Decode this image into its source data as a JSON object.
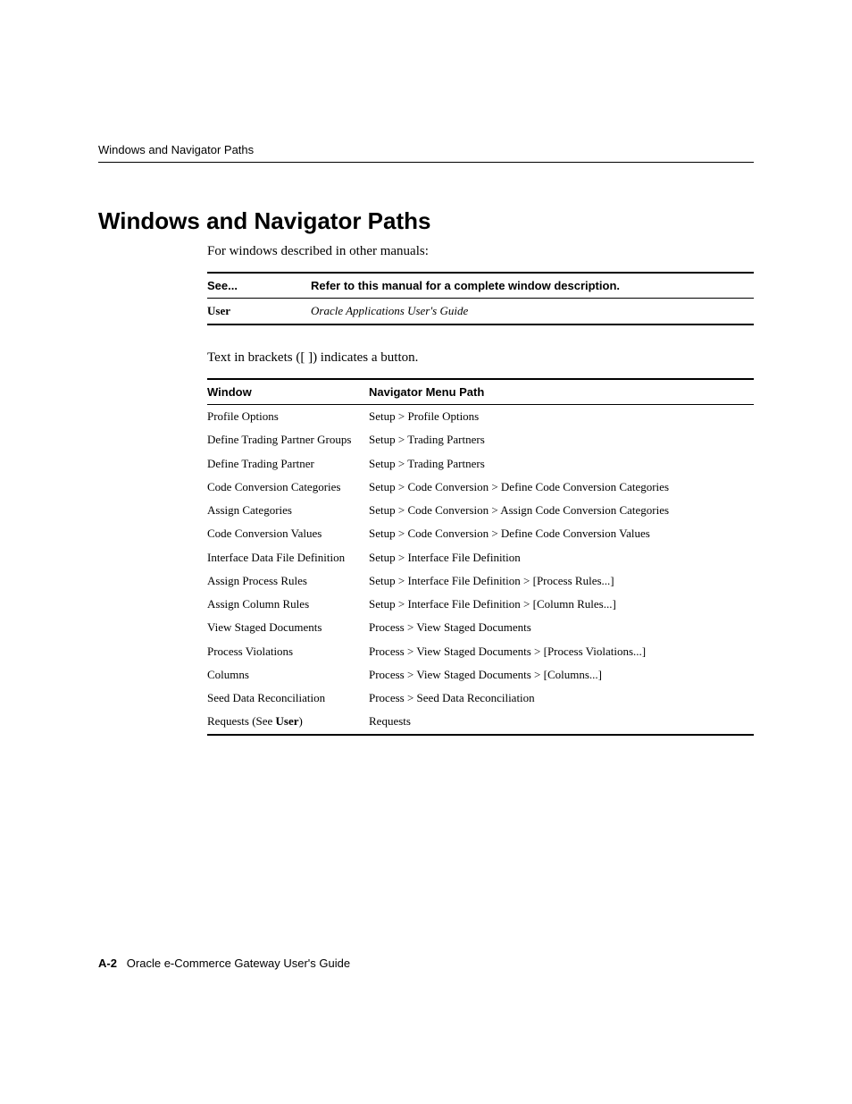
{
  "header": {
    "running_head": "Windows and Navigator Paths"
  },
  "title": "Windows and Navigator Paths",
  "intro": "For windows described in other manuals:",
  "ref_table": {
    "headers": {
      "see": "See...",
      "refer": "Refer to this manual for a complete window description."
    },
    "rows": [
      {
        "see": "User",
        "refer": "Oracle Applications User's Guide"
      }
    ]
  },
  "note": "Text in brackets ([ ]) indicates a button.",
  "nav_table": {
    "headers": {
      "window": "Window",
      "path": "Navigator Menu Path"
    },
    "rows": [
      {
        "window": "Profile Options",
        "path": "Setup > Profile Options"
      },
      {
        "window": "Define Trading Partner Groups",
        "path": "Setup > Trading Partners"
      },
      {
        "window": "Define Trading Partner",
        "path": "Setup > Trading Partners"
      },
      {
        "window": "Code Conversion Categories",
        "path": "Setup > Code Conversion > Define Code Conversion Categories"
      },
      {
        "window": "Assign Categories",
        "path": "Setup > Code Conversion > Assign Code Conversion Categories"
      },
      {
        "window": "Code Conversion Values",
        "path": "Setup > Code Conversion > Define Code Conversion Values"
      },
      {
        "window": "Interface Data File Definition",
        "path": "Setup > Interface File Definition"
      },
      {
        "window": "Assign Process Rules",
        "path": "Setup > Interface File Definition > [Process Rules...]"
      },
      {
        "window": "Assign Column Rules",
        "path": "Setup > Interface File Definition > [Column Rules...]"
      },
      {
        "window": "View Staged Documents",
        "path": "Process > View Staged Documents"
      },
      {
        "window": "Process Violations",
        "path": "Process > View Staged Documents > [Process Violations...]"
      },
      {
        "window": "Columns",
        "path": "Process > View Staged Documents > [Columns...]"
      },
      {
        "window": "Seed Data Reconciliation",
        "path": "Process > Seed Data Reconciliation"
      },
      {
        "window_prefix": "Requests (See ",
        "window_bold": "User",
        "window_suffix": ")",
        "path": "Requests"
      }
    ]
  },
  "footer": {
    "page_number": "A-2",
    "book_title": "Oracle e-Commerce Gateway User's Guide"
  }
}
